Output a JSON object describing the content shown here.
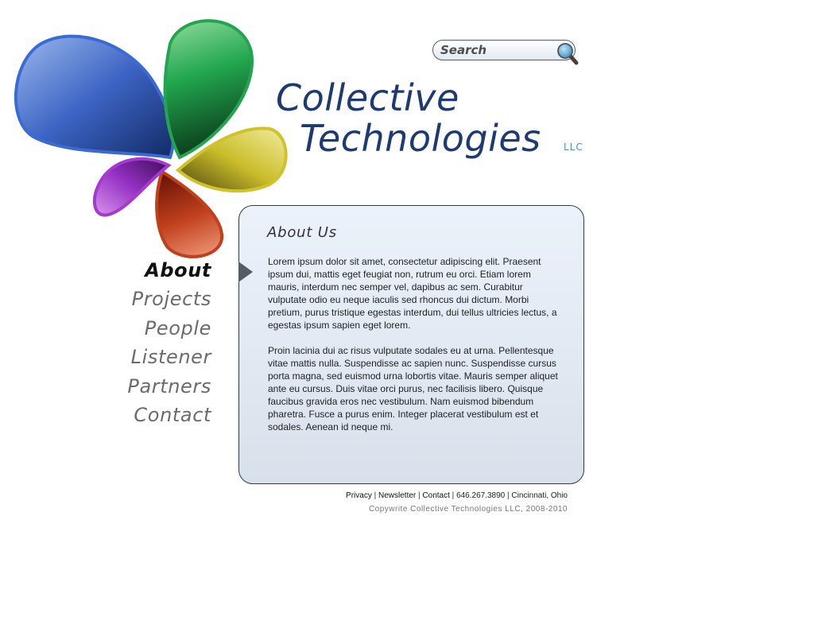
{
  "header": {
    "brand_line1": "Collective",
    "brand_line2": "Technologies",
    "brand_suffix": "LLC",
    "brand_color": "#1e3a72",
    "suffix_color": "#4f8fd0"
  },
  "search": {
    "placeholder": "Search",
    "value": ""
  },
  "logo": {
    "petal_colors": [
      "#4f7fd6",
      "#21a04a",
      "#d8cf3c",
      "#c63e1f",
      "#a03fc8"
    ]
  },
  "nav": {
    "items": [
      {
        "label": "About",
        "active": true
      },
      {
        "label": "Projects",
        "active": false
      },
      {
        "label": "People",
        "active": false
      },
      {
        "label": "Listener",
        "active": false
      },
      {
        "label": "Partners",
        "active": false
      },
      {
        "label": "Contact",
        "active": false
      }
    ]
  },
  "content": {
    "title": "About Us",
    "paragraphs": [
      "Lorem ipsum dolor sit amet, consectetur adipiscing elit. Praesent ipsum dui, mattis eget feugiat non, rutrum eu orci. Etiam lorem mauris, interdum nec semper vel, dapibus ac sem. Curabitur vulputate odio eu neque iaculis sed rhoncus dui dictum. Morbi pretium, purus tristique egestas interdum, dui tellus ultricies lectus, a egestas ipsum sapien eget lorem.",
      "Proin lacinia dui ac risus vulputate sodales eu at urna. Pellentesque vitae mattis nulla. Suspendisse ac sapien nunc. Suspendisse cursus porta magna, sed euismod urna lobortis vitae. Mauris semper aliquet ante eu cursus. Duis vitae orci purus, nec facilisis libero. Quisque faucibus gravida eros nec vestibulum. Nam euismod bibendum pharetra. Fusce a purus enim. Integer placerat vestibulum est et sodales. Aenean id neque mi."
    ]
  },
  "footer": {
    "links": {
      "privacy": "Privacy",
      "newsletter": "Newsletter",
      "contact": "Contact"
    },
    "separator": "|",
    "phone": "646.267.3890",
    "location": "Cincinnati, Ohio",
    "copyright": "Copywrite Collective Technologies LLC, 2008-2010"
  }
}
